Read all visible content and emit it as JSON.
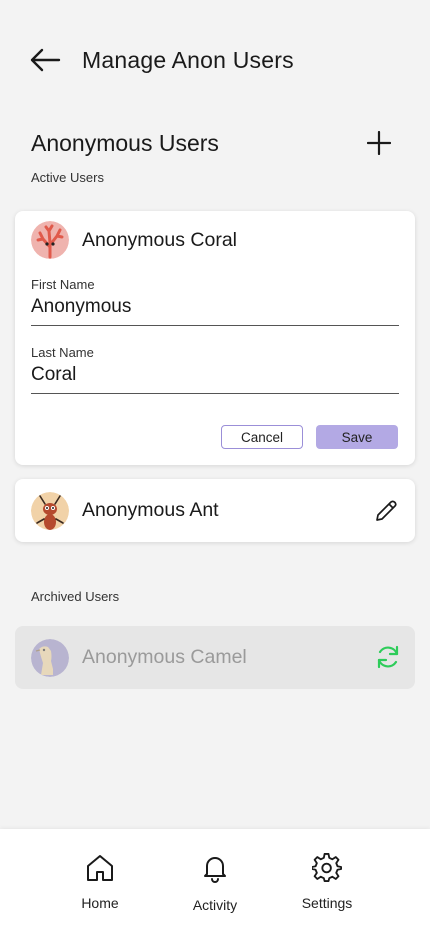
{
  "header": {
    "title": "Manage Anon Users",
    "back_icon": "arrow-left-icon"
  },
  "section": {
    "title": "Anonymous Users",
    "add_icon": "plus-icon",
    "active_label": "Active Users",
    "archived_label": "Archived Users"
  },
  "editing_user": {
    "name": "Anonymous Coral",
    "avatar": "coral-avatar",
    "first_name_label": "First Name",
    "first_name_value": "Anonymous",
    "last_name_label": "Last Name",
    "last_name_value": "Coral",
    "cancel_label": "Cancel",
    "save_label": "Save"
  },
  "active_users": [
    {
      "name": "Anonymous Ant",
      "avatar": "ant-avatar",
      "action_icon": "pencil-icon"
    }
  ],
  "archived_users": [
    {
      "name": "Anonymous Camel",
      "avatar": "camel-avatar",
      "action_icon": "restore-icon"
    }
  ],
  "colors": {
    "accent": "#b3a9e4",
    "accent_border": "#9b8fd8",
    "restore": "#2ecc5a",
    "background": "#f3f3f3"
  },
  "nav": {
    "items": [
      {
        "label": "Home",
        "icon": "home-icon"
      },
      {
        "label": "Activity",
        "icon": "bell-icon"
      },
      {
        "label": "Settings",
        "icon": "gear-icon"
      }
    ]
  }
}
